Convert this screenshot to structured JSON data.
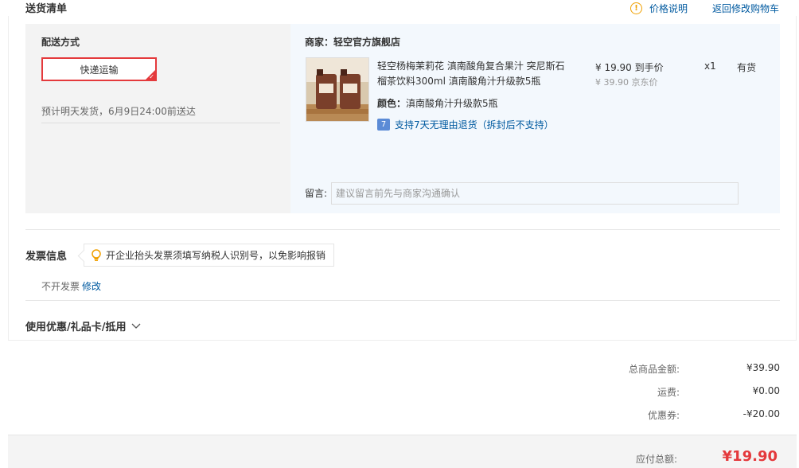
{
  "header": {
    "title": "送货清单",
    "price_note": "价格说明",
    "back_to_cart": "返回修改购物车"
  },
  "shipping": {
    "label": "配送方式",
    "method": "快递运输",
    "estimate": "预计明天发货，6月9日24:00前送达"
  },
  "shop": {
    "name_prefix": "商家：",
    "name": "轻空官方旗舰店"
  },
  "item": {
    "name": "轻空杨梅茉莉花 滇南酸角复合果汁 突尼斯石榴茶饮料300ml 滇南酸角汁升级款5瓶",
    "color_label": "颜色：",
    "color_value": "滇南酸角汁升级款5瓶",
    "return_icon_text": "7",
    "return_policy": "支持7天无理由退货（拆封后不支持）",
    "price": "¥ 19.90 到手价",
    "orig_price": "¥ 39.90 京东价",
    "qty": "x1",
    "stock": "有货"
  },
  "message": {
    "label": "留言:",
    "placeholder": "建议留言前先与商家沟通确认"
  },
  "invoice": {
    "title": "发票信息",
    "tip": "开企业抬头发票须填写纳税人识别号，以免影响报销",
    "value": "不开发票",
    "edit": "修改"
  },
  "coupon": {
    "label": "使用优惠/礼品卡/抵用"
  },
  "summary": {
    "goods_label": "总商品金额:",
    "goods_value": "¥39.90",
    "freight_label": "运费:",
    "freight_value": "¥0.00",
    "coupon_label": "优惠券:",
    "coupon_value": "-¥20.00",
    "pay_label": "应付总额:",
    "pay_value": "¥19.90"
  },
  "colors": {
    "accent_red": "#e4393c",
    "link_blue": "#005aa0",
    "warn_orange": "#f0a000"
  }
}
